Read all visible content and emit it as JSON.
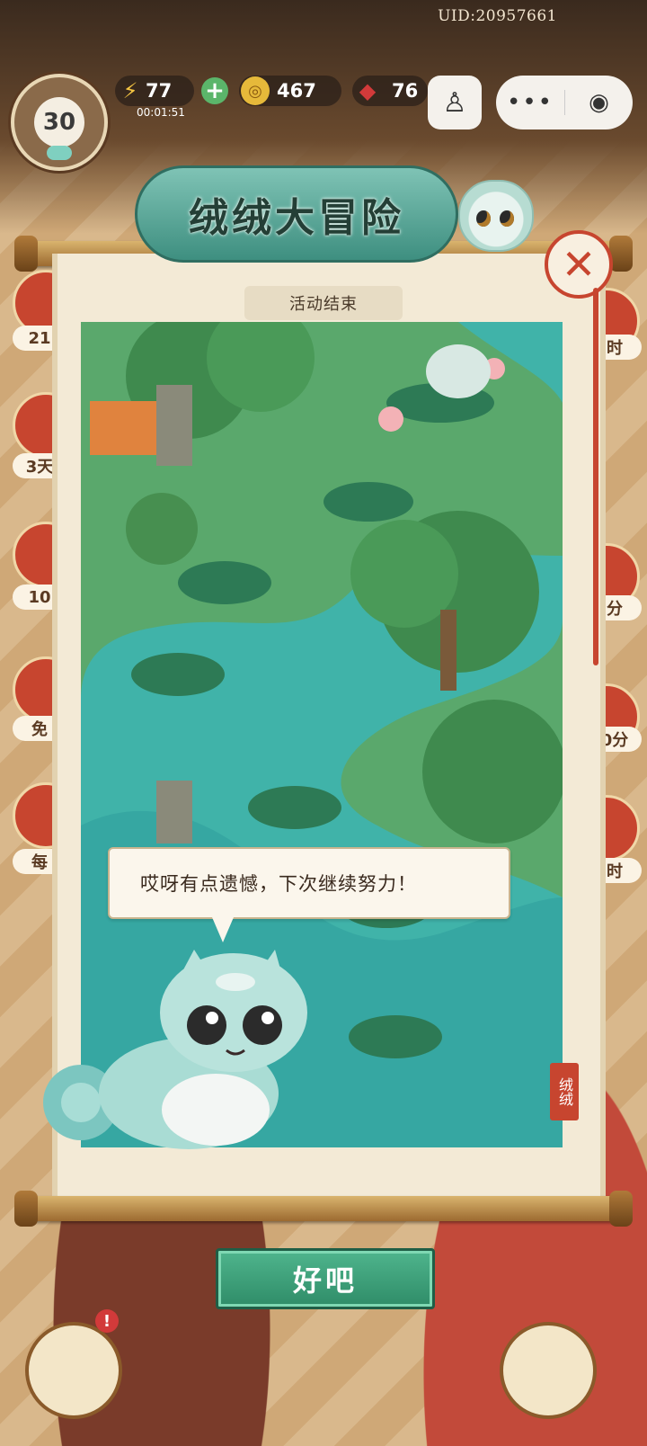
{
  "hud": {
    "uid": "UID:20957661",
    "level": "30",
    "energy": "77",
    "energy_timer": "00:01:51",
    "coins": "467",
    "gems": "76"
  },
  "side_labels": {
    "left": [
      "21",
      "3天",
      "10",
      "免",
      "每"
    ],
    "right": [
      "时",
      "分",
      "0分",
      "时"
    ]
  },
  "dialog": {
    "title": "绒绒大冒险",
    "status_tag": "活动结束",
    "message": "哎呀有点遗憾，下次继续努力！",
    "seal_text": "绒绒",
    "confirm_label": "好吧"
  },
  "colors": {
    "accent_teal": "#3e8f80",
    "water": "#3fb3ad",
    "button_green": "#2f8c68",
    "close_red": "#c7452f"
  },
  "icons": [
    "lightning-icon",
    "plus-icon",
    "coin-icon",
    "gem-icon",
    "joystick-icon",
    "more-icon",
    "target-icon",
    "close-icon",
    "cat-mascot-icon",
    "notification-badge-icon"
  ]
}
